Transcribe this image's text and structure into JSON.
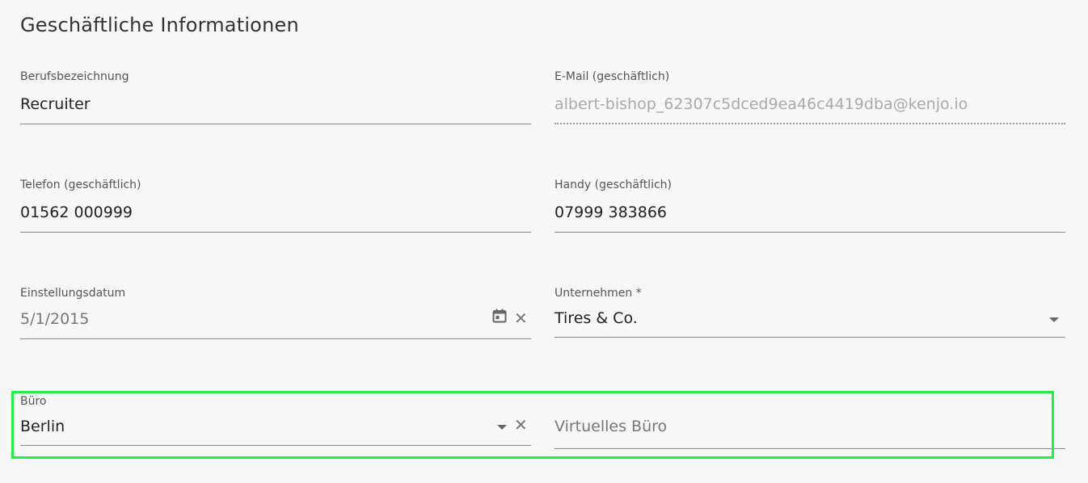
{
  "section": {
    "title": "Geschäftliche Informationen"
  },
  "fields": {
    "job_title": {
      "label": "Berufsbezeichnung",
      "value": "Recruiter"
    },
    "work_email": {
      "label": "E-Mail (geschäftlich)",
      "value": "albert-bishop_62307c5dced9ea46c4419dba@kenjo.io"
    },
    "work_phone": {
      "label": "Telefon (geschäftlich)",
      "value": "01562 000999"
    },
    "work_mobile": {
      "label": "Handy (geschäftlich)",
      "value": "07999 383866"
    },
    "hire_date": {
      "label": "Einstellungsdatum",
      "value": "5/1/2015",
      "calendar_icon": "calendar-icon",
      "clear_icon": "close-icon"
    },
    "company": {
      "label": "Unternehmen *",
      "value": "Tires & Co.",
      "dropdown_icon": "chevron-down-icon"
    },
    "office": {
      "label": "Büro",
      "value": "Berlin",
      "dropdown_icon": "chevron-down-icon",
      "clear_icon": "close-icon"
    },
    "virtual_office": {
      "placeholder": "Virtuelles Büro"
    }
  },
  "colors": {
    "highlight": "#22ee44"
  }
}
